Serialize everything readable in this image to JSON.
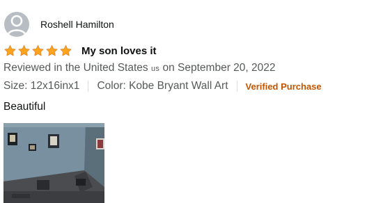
{
  "reviewer": {
    "name": "Roshell Hamilton",
    "avatar_icon": "default-profile-avatar-icon"
  },
  "review": {
    "rating": 5,
    "rating_max": 5,
    "star_color": "#ffa41c",
    "title": "My son loves it",
    "date_prefix": "Reviewed in the United States",
    "country_code": "us",
    "date_suffix": "on September 20, 2022",
    "size": "Size: 12x16inx1",
    "color": "Color: Kobe Bryant Wall Art",
    "verified": "Verified Purchase",
    "verified_color": "#c45500",
    "body": "Beautiful"
  }
}
